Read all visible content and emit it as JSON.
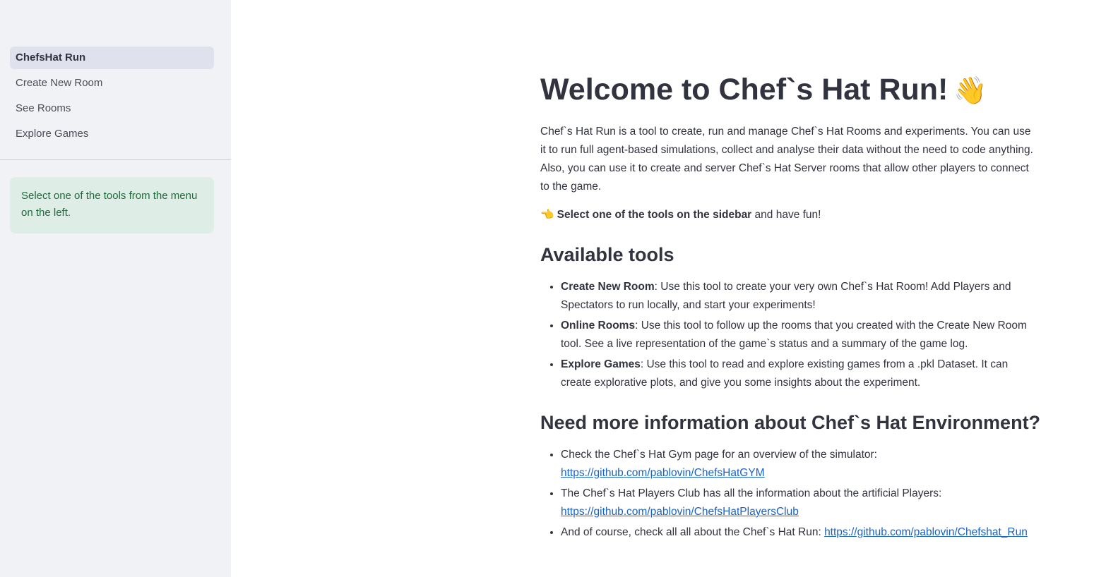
{
  "sidebar": {
    "items": [
      {
        "label": "ChefsHat Run"
      },
      {
        "label": "Create New Room"
      },
      {
        "label": "See Rooms"
      },
      {
        "label": "Explore Games"
      }
    ],
    "info": "Select one of the tools from the menu on the left."
  },
  "main": {
    "title": "Welcome to Chef`s Hat Run!",
    "title_emoji": "👋",
    "intro": "Chef`s Hat Run is a tool to create, run and manage Chef`s Hat Rooms and experiments. You can use it to run full agent-based simulations, collect and analyse their data without the need to code anything. Also, you can use it to create and server Chef`s Hat Server rooms that allow other players to connect to the game.",
    "cta_emoji": "👈",
    "cta_bold": "Select one of the tools on the sidebar",
    "cta_rest": " and have fun!",
    "tools_heading": "Available tools",
    "tools": [
      {
        "name": "Create New Room",
        "desc": ": Use this tool to create your very own Chef`s Hat Room! Add Players and Spectators to run locally, and start your experiments!"
      },
      {
        "name": "Online Rooms",
        "desc": ": Use this tool to follow up the rooms that you created with the Create New Room tool. See a live representation of the game`s status and a summary of the game log."
      },
      {
        "name": "Explore Games",
        "desc": ": Use this tool to read and explore existing games from a .pkl Dataset. It can create explorative plots, and give you some insights about the experiment."
      }
    ],
    "info_heading": "Need more information about Chef`s Hat Environment?",
    "links": [
      {
        "text": "Check the Chef`s Hat Gym page for an overview of the simulator: ",
        "url": "https://github.com/pablovin/ChefsHatGYM"
      },
      {
        "text": "The Chef`s Hat Players Club has all the information about the artificial Players: ",
        "url": "https://github.com/pablovin/ChefsHatPlayersClub"
      },
      {
        "text": "And of course, check all all about the Chef`s Hat Run: ",
        "url": "https://github.com/pablovin/Chefshat_Run"
      }
    ]
  }
}
